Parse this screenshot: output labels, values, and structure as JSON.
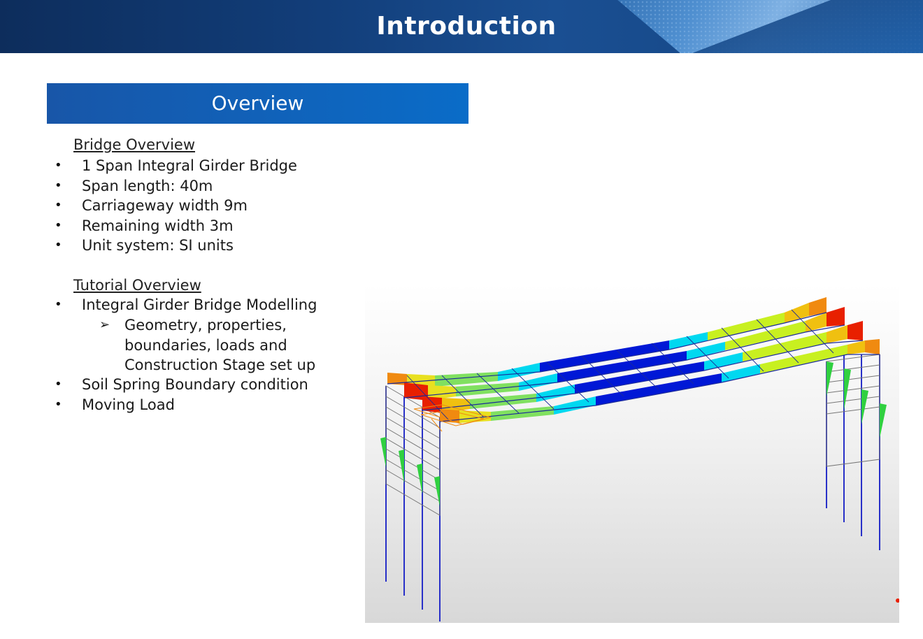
{
  "header": {
    "title": "Introduction"
  },
  "section": {
    "title": "Overview"
  },
  "bridge_overview": {
    "heading": "Bridge Overview",
    "items": [
      "1 Span Integral Girder Bridge",
      "Span length: 40m",
      "Carriageway width 9m",
      "Remaining width 3m",
      "Unit system: SI units"
    ]
  },
  "tutorial_overview": {
    "heading": "Tutorial Overview",
    "items": [
      "Integral Girder Bridge Modelling",
      "Soil Spring Boundary condition",
      "Moving Load"
    ],
    "sub_items": [
      "Geometry, properties,\nboundaries, loads and\nConstruction Stage set up"
    ]
  },
  "glyphs": {
    "bullet": "•",
    "arrow": "➢"
  },
  "colors": {
    "header_bg": "#123e7a",
    "section_bar": "#0a6cc8",
    "result_blue": "#0018d6",
    "result_cyan": "#00d8f0",
    "result_green": "#4ee04a",
    "result_yellow": "#e8f000",
    "result_orange": "#f08a10",
    "result_red": "#e82000"
  }
}
